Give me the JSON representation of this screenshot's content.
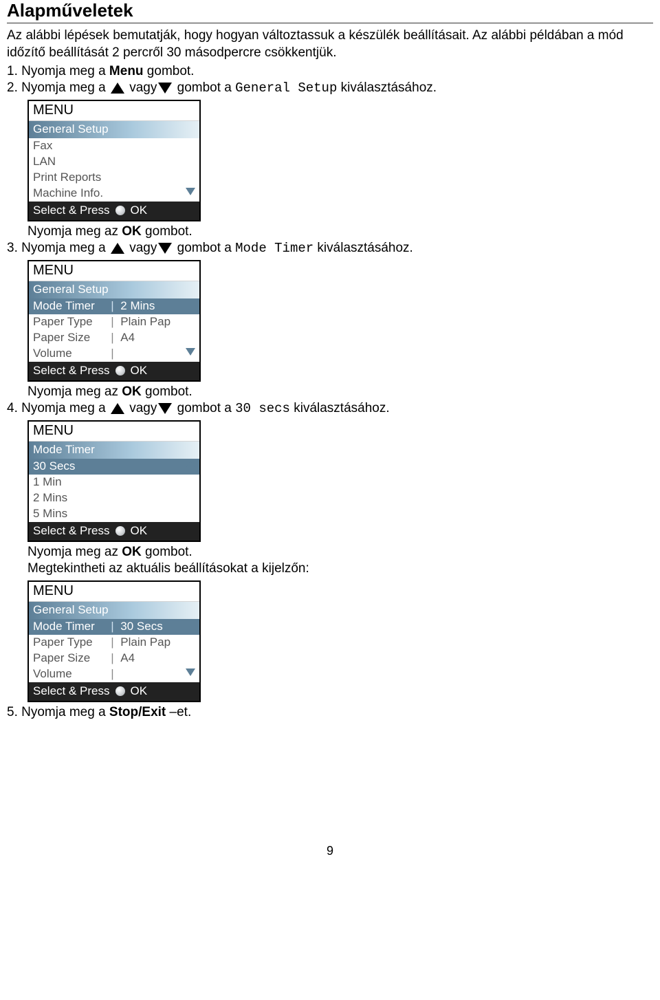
{
  "heading": "Alapműveletek",
  "intro1": "Az alábbi lépések bemutatják, hogy hogyan változtassuk a készülék beállításait. Az alábbi példában a mód időzítő beállítását 2 percről 30 másodpercre csökkentjük.",
  "steps": {
    "s1": {
      "num": "1.",
      "pre": "Nyomja meg a ",
      "menu": "Menu",
      "post": " gombot."
    },
    "s2": {
      "num": "2.",
      "pre": "Nyomja meg a ",
      "mid": " vagy",
      "post1": " gombot a ",
      "code": "General Setup",
      "post2": " kiválasztásához."
    },
    "press_ok": "Nyomja meg az ",
    "ok_word": "OK",
    "press_ok_post": " gombot.",
    "s3": {
      "num": "3.",
      "pre": "Nyomja meg a ",
      "mid": " vagy",
      "post1": " gombot a ",
      "code": "Mode Timer",
      "post2": "  kiválasztásához."
    },
    "s4": {
      "num": "4.",
      "pre": "Nyomja meg a ",
      "mid": " vagy",
      "post1": " gombot a ",
      "code": "30 secs",
      "post2": "  kiválasztásához."
    },
    "s5_text": "Megtekintheti az aktuális beállításokat a kijelzőn:",
    "s5": {
      "num": "5.",
      "pre": "Nyomja meg a ",
      "bold": "Stop/Exit",
      "post": " –et."
    }
  },
  "lcd_common": {
    "title": "MENU",
    "foot_select": "Select & Press",
    "foot_ok": "OK"
  },
  "lcd1": {
    "hdr": "General Setup",
    "rows": [
      "Fax",
      "LAN",
      "Print Reports",
      "Machine Info."
    ]
  },
  "lcd2": {
    "hdr": "General Setup",
    "rows": [
      {
        "l": "Mode Timer",
        "v": "2 Mins",
        "sel": true
      },
      {
        "l": "Paper Type",
        "v": "Plain Pap"
      },
      {
        "l": "Paper Size",
        "v": "A4"
      },
      {
        "l": "Volume",
        "v": ""
      }
    ]
  },
  "lcd3": {
    "hdr": "Mode Timer",
    "rows": [
      {
        "l": "30 Secs",
        "sel": true,
        "up": true
      },
      {
        "l": "1 Min"
      },
      {
        "l": "2 Mins"
      },
      {
        "l": "5 Mins"
      }
    ]
  },
  "lcd4": {
    "hdr": "General Setup",
    "rows": [
      {
        "l": "Mode Timer",
        "v": "30 Secs",
        "sel": true
      },
      {
        "l": "Paper Type",
        "v": "Plain Pap"
      },
      {
        "l": "Paper Size",
        "v": "A4"
      },
      {
        "l": "Volume",
        "v": ""
      }
    ]
  },
  "page_num": "9"
}
